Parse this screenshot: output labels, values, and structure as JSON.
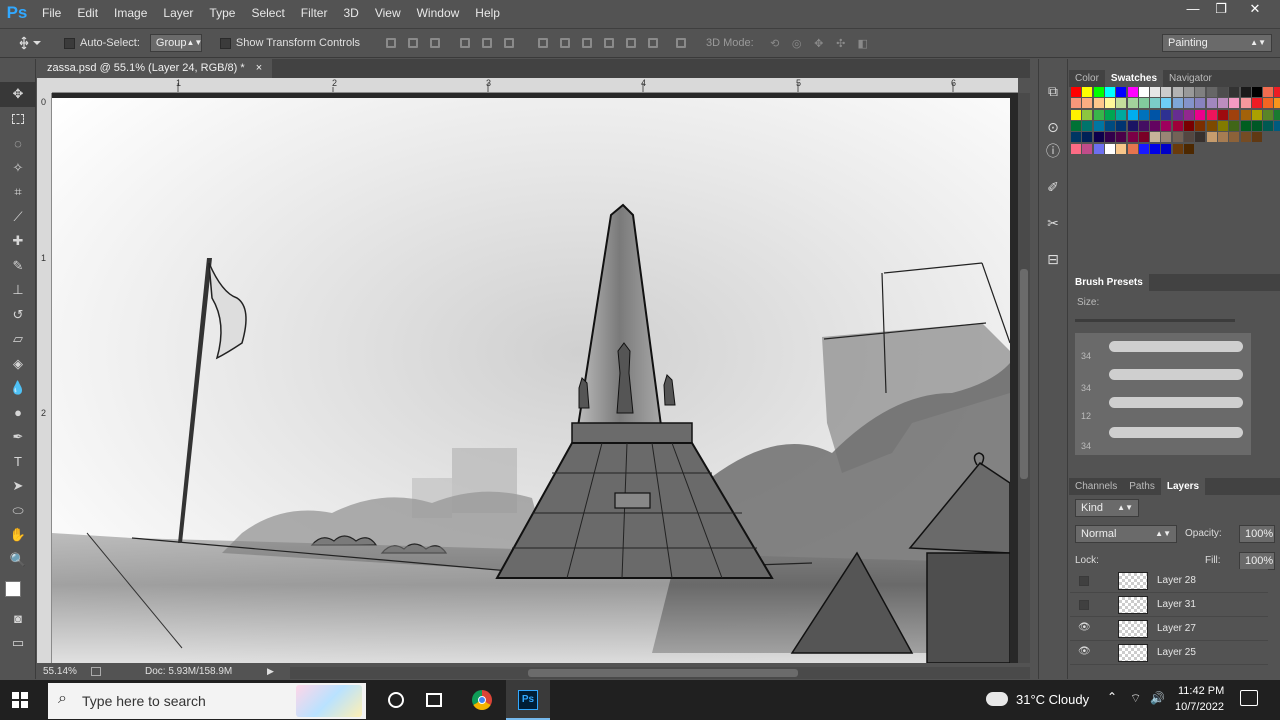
{
  "app": {
    "logo": "Ps"
  },
  "menu": [
    "File",
    "Edit",
    "Image",
    "Layer",
    "Type",
    "Select",
    "Filter",
    "3D",
    "View",
    "Window",
    "Help"
  ],
  "window_controls": {
    "minimize": "—",
    "restore": "❐",
    "close": "✕"
  },
  "options": {
    "auto_select_label": "Auto-Select:",
    "auto_select_value": "Group",
    "show_transform_label": "Show Transform Controls",
    "mode_3d_label": "3D Mode:",
    "workspace": "Painting"
  },
  "document": {
    "tab_title": "zassa.psd @ 55.1% (Layer 24, RGB/8) *",
    "tab_close": "×",
    "ruler_top": [
      "1",
      "2",
      "3",
      "4",
      "5",
      "6"
    ],
    "ruler_left": [
      "0",
      "1",
      "2"
    ]
  },
  "status": {
    "zoom": "55.14%",
    "doc": "Doc: 5.93M/158.9M"
  },
  "panels": {
    "color_tabs": [
      "Color",
      "Swatches",
      "Navigator"
    ],
    "brush_presets_title": "Brush Presets",
    "size_label": "Size:",
    "brush_sizes": [
      "34",
      "34",
      "12",
      "34"
    ],
    "layer_tabs": [
      "Channels",
      "Paths",
      "Layers"
    ],
    "kind_label": "Kind",
    "blend_mode": "Normal",
    "opacity_label": "Opacity:",
    "opacity_value": "100%",
    "lock_label": "Lock:",
    "fill_label": "Fill:",
    "fill_value": "100%",
    "layers": [
      {
        "name": "Layer 28",
        "visible": false
      },
      {
        "name": "Layer 31",
        "visible": false
      },
      {
        "name": "Layer 27",
        "visible": true
      },
      {
        "name": "Layer 25",
        "visible": true
      }
    ]
  },
  "taskbar": {
    "search_placeholder": "Type here to search",
    "weather": "31°C  Cloudy",
    "time": "11:42 PM",
    "date": "10/7/2022"
  },
  "colors": {
    "ui_bg": "#535353",
    "ps_blue": "#31a8ff",
    "taskbar": "#202020"
  }
}
